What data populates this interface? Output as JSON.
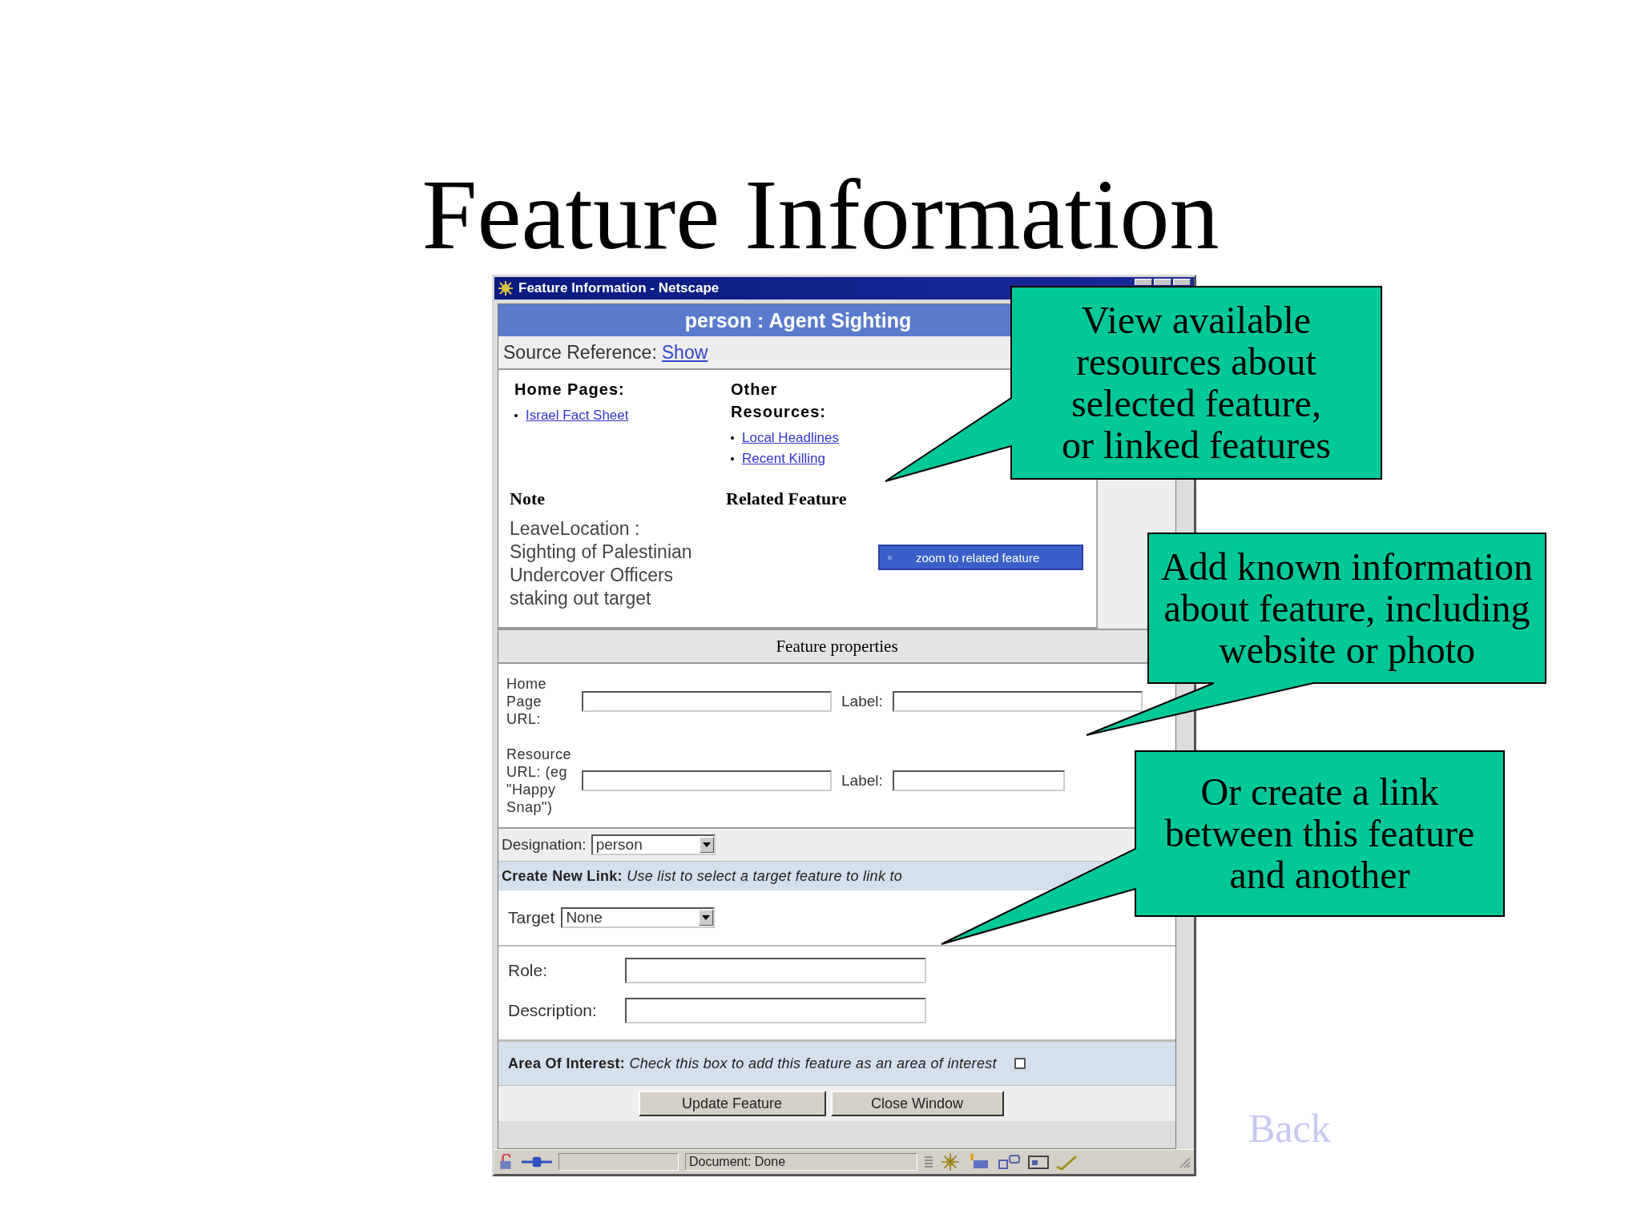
{
  "slide_title": "Feature Information",
  "window": {
    "title": "Feature Information - Netscape"
  },
  "header": "person : Agent Sighting",
  "source_reference": {
    "label": "Source Reference:",
    "link": "Show"
  },
  "home_pages": {
    "heading": "Home Pages:",
    "links": [
      "Israel Fact Sheet"
    ]
  },
  "other_resources": {
    "heading": "Other Resources:",
    "links": [
      "Local Headlines",
      "Recent Killing"
    ]
  },
  "note": {
    "heading": "Note",
    "lines": [
      "LeaveLocation :",
      "Sighting of Palestinian Undercover Officers staking out target"
    ]
  },
  "related_feature": {
    "heading": "Related Feature",
    "button": "zoom to related feature"
  },
  "feature_properties": {
    "heading": "Feature properties",
    "rows": [
      {
        "label": "Home Page URL:",
        "label_field": "Label:"
      },
      {
        "label": "Resource URL: (eg \"Happy Snap\")",
        "label_field": "Label:"
      }
    ]
  },
  "designation": {
    "label": "Designation:",
    "value": "person"
  },
  "create_link": {
    "label": "Create New Link:",
    "hint": "Use list to select a target feature to link to"
  },
  "target": {
    "label": "Target",
    "value": "None"
  },
  "link_fields": [
    "Role:",
    "Description:"
  ],
  "area_of_interest": {
    "label": "Area Of Interest:",
    "hint": "Check this box to add this feature as an area of interest",
    "checked": false
  },
  "buttons": [
    "Update Feature",
    "Close Window"
  ],
  "status_bar": {
    "text": "Document: Done"
  },
  "callouts": [
    {
      "lines": [
        "View available",
        "resources about",
        "selected feature,",
        "or linked features"
      ]
    },
    {
      "lines": [
        "Add known information",
        "about feature, including",
        "website or photo"
      ]
    },
    {
      "lines": [
        "Or create a link",
        "between this feature",
        "and another"
      ]
    }
  ],
  "back_link": "Back"
}
